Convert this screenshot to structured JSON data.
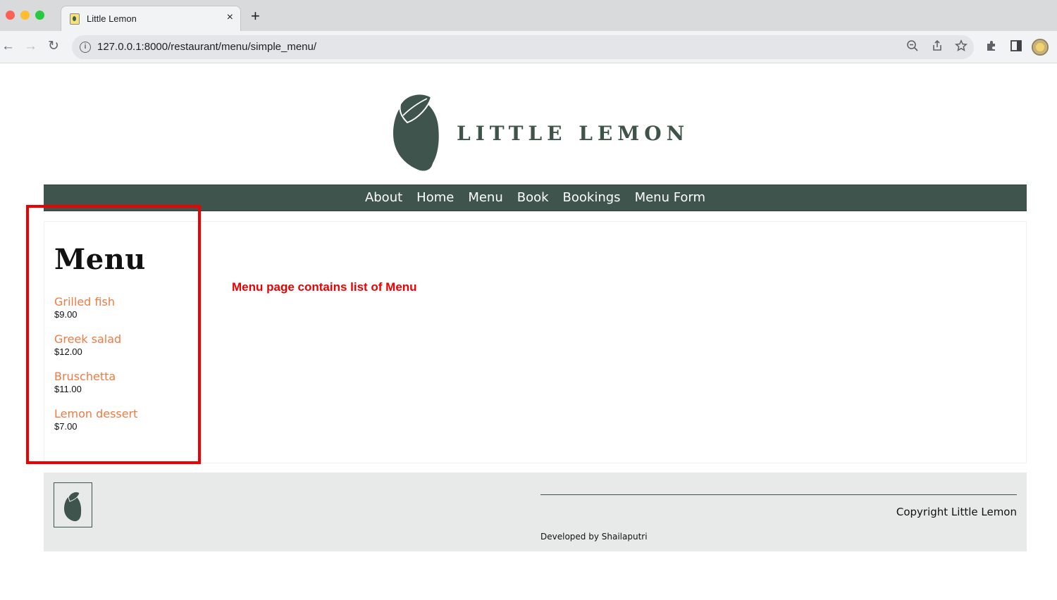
{
  "browser": {
    "tab_title": "Little Lemon",
    "tab_close": "×",
    "new_tab": "+",
    "url": "127.0.0.1:8000/restaurant/menu/simple_menu/",
    "icons": [
      "back-arrow-icon",
      "forward-arrow-icon",
      "reload-icon",
      "info-icon",
      "zoom-icon",
      "share-icon",
      "star-icon",
      "extensions-icon",
      "sidebar-icon",
      "profile-avatar"
    ]
  },
  "header": {
    "logo_text": "LITTLE LEMON"
  },
  "nav": {
    "links": [
      "About",
      "Home",
      "Menu",
      "Book",
      "Bookings",
      "Menu Form"
    ]
  },
  "main": {
    "heading": "Menu",
    "items": [
      {
        "name": "Grilled fish",
        "price": "$9.00"
      },
      {
        "name": "Greek salad",
        "price": "$12.00"
      },
      {
        "name": "Bruschetta",
        "price": "$11.00"
      },
      {
        "name": "Lemon dessert",
        "price": "$7.00"
      }
    ]
  },
  "annotation": {
    "text": "Menu page contains list of Menu"
  },
  "footer": {
    "copyright": "Copyright Little Lemon",
    "developer": "Developed by Shailaputri"
  },
  "colors": {
    "brand_green": "#3f544c",
    "item_orange": "#ee7b44",
    "annotation_red": "#ef0000",
    "footer_bg": "#e8eae9"
  }
}
